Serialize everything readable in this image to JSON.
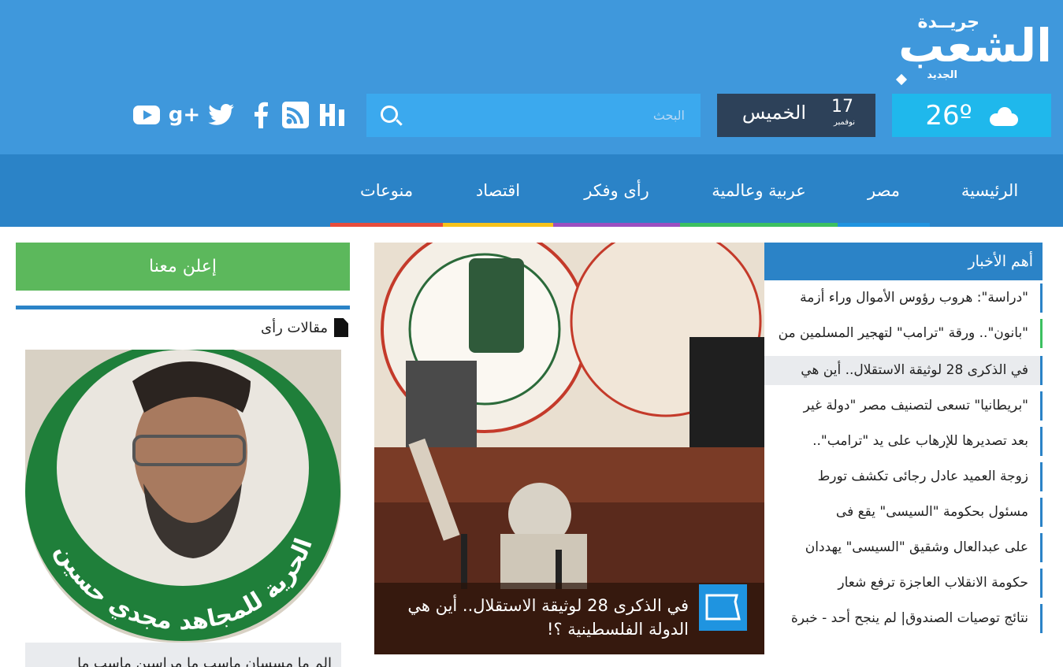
{
  "site": {
    "logo_small": "جريــدة",
    "logo_main": "الشعب",
    "logo_sub": "الجديد"
  },
  "weather": {
    "temperature": "26º",
    "icon": "cloud-icon"
  },
  "date": {
    "day_number": "17",
    "month": "نوفمبر",
    "weekday": "الخميس"
  },
  "search": {
    "placeholder": "البحث",
    "value": ""
  },
  "social": [
    "youtube-icon",
    "google-plus-icon",
    "twitter-icon",
    "facebook-icon",
    "rss-icon",
    "site-logo-icon"
  ],
  "nav": {
    "items": [
      {
        "label": "الرئيسية",
        "color": "#2b83c7"
      },
      {
        "label": "مصر",
        "color": "#1f94e0"
      },
      {
        "label": "عربية وعالمية",
        "color": "#3cc060"
      },
      {
        "label": "رأى وفكر",
        "color": "#9b4fc1"
      },
      {
        "label": "اقتصاد",
        "color": "#f6c21a"
      },
      {
        "label": "منوعات",
        "color": "#e74c3c"
      }
    ]
  },
  "top_news": {
    "title": "أهم الأخبار",
    "items": [
      {
        "text": "\"دراسة\": هروب رؤوس الأموال وراء أزمة",
        "bar": "#2b83c7"
      },
      {
        "text": "\"بانون\".. ورقة \"ترامب\" لتهجير المسلمين من",
        "bar": "#3cc060"
      },
      {
        "text": "في الذكرى 28 لوثيقة الاستقلال.. أين هي",
        "bar": "#2b83c7"
      },
      {
        "text": "\"بريطانيا\" تسعى لتصنيف مصر \"دولة غير",
        "bar": "#2b83c7"
      },
      {
        "text": "بعد تصديرها للإرهاب على يد \"ترامب\"..",
        "bar": "#2b83c7"
      },
      {
        "text": "زوجة العميد عادل رجائى تكشف تورط",
        "bar": "#2b83c7"
      },
      {
        "text": "مسئول بحكومة \"السيسى\" يقع فى",
        "bar": "#2b83c7"
      },
      {
        "text": "على عبدالعال وشقيق \"السيسى\" يهددان",
        "bar": "#2b83c7"
      },
      {
        "text": "حكومة الانقلاب العاجزة ترفع شعار",
        "bar": "#2b83c7"
      },
      {
        "text": "نتائج توصيات الصندوق| لم ينجح أحد - خبرة",
        "bar": "#2b83c7"
      }
    ]
  },
  "featured": {
    "caption": "في الذكرى 28 لوثيقة الاستقلال.. أين هي الدولة الفلسطينية ؟!",
    "icon": "egypt-map-icon"
  },
  "sidebar": {
    "ad_label": "إعلن معنا",
    "opinion_title": "مقالات رأى",
    "opinion_photo_text": "الحرية للمجاهد مجدي حسين",
    "opinion_excerpt": "الم ما مسسان ماسب ما مراسين ماسب ما"
  }
}
